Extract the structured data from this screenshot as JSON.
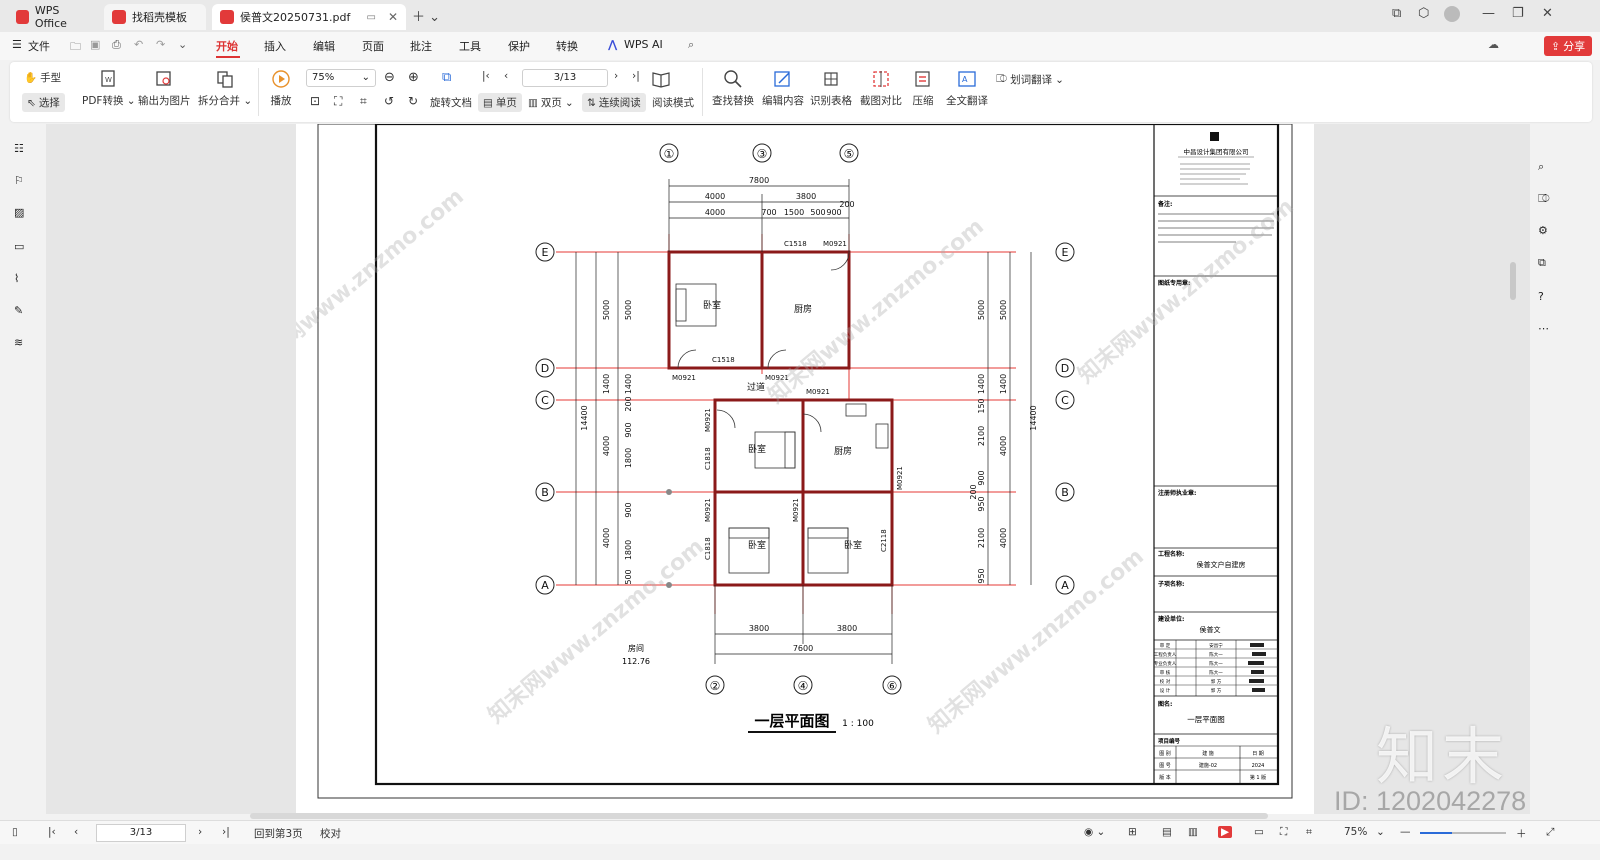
{
  "tabs": [
    {
      "label": "WPS Office"
    },
    {
      "label": "找稻壳模板"
    },
    {
      "label": "侯普文20250731.pdf"
    }
  ],
  "menu": {
    "file": "文件",
    "items": [
      "开始",
      "插入",
      "编辑",
      "页面",
      "批注",
      "工具",
      "保护",
      "转换"
    ],
    "wps_ai": "WPS AI",
    "share": "分享"
  },
  "toolbar": {
    "hand": "手型",
    "select": "选择",
    "pdf_convert": "PDF转换",
    "export_image": "输出为图片",
    "split_merge": "拆分合并",
    "play": "播放",
    "zoom_value": "75%",
    "page_value": "3/13",
    "rotate_doc": "旋转文档",
    "single_page": "单页",
    "double_page": "双页",
    "continuous": "连续阅读",
    "read_mode": "阅读模式",
    "find_replace": "查找替换",
    "edit_content": "编辑内容",
    "recognize_table": "识别表格",
    "screenshot_compare": "截图对比",
    "compress": "压缩",
    "full_translate": "全文翻译",
    "word_translate": "划词翻译"
  },
  "drawing": {
    "title": "一层平面图",
    "scale": "1 : 100",
    "axis_top": [
      "①",
      "③",
      "⑤"
    ],
    "axis_bottom": [
      "②",
      "④",
      "⑥"
    ],
    "axis_rows": [
      "E",
      "D",
      "C",
      "B",
      "A"
    ],
    "dims_top": [
      "7800",
      "4000",
      "3800",
      "4000",
      "700",
      "1500",
      "500",
      "900",
      "200"
    ],
    "dims_bottom": [
      "3800",
      "3800",
      "7600"
    ],
    "dims_left_outer": "14400",
    "dims_left": [
      "5000",
      "5000",
      "1400",
      "1400",
      "4000",
      "4000",
      "200",
      "500",
      "900",
      "1800",
      "200",
      "500",
      "900",
      "1800",
      "500"
    ],
    "dims_right": [
      "5000",
      "5000",
      "1400",
      "1400",
      "4000",
      "4000",
      "150",
      "2100",
      "350",
      "200",
      "900",
      "950",
      "2100",
      "950"
    ],
    "dims_right_outer": "14400",
    "rooms": [
      "卧室",
      "厨房",
      "过道",
      "卧室",
      "厨房",
      "卧室",
      "卧室"
    ],
    "door_window_labels": [
      "C1518",
      "M0921",
      "C1518",
      "M0921",
      "M0921",
      "M0921",
      "M0921",
      "C1818",
      "M0921",
      "M0921",
      "C1818",
      "C2118",
      "M0921"
    ],
    "area_label": "房间",
    "area_value": "112.76",
    "title_block": {
      "company": "中昌设计集团有限公司",
      "notes_label": "备注:",
      "stamp_label": "图纸专用章:",
      "reg_label": "注册师执业章:",
      "project_label": "工程名称:",
      "project_value": "侯普文户自建房",
      "subitem_label": "子项名称:",
      "client_label": "建设单位:",
      "client_value": "侯普文",
      "drawing_name_label": "图名:",
      "drawing_name_value": "一层平面图",
      "proj_no_label": "项目编号",
      "sig_rows": [
        "审 定",
        "工程负责人",
        "专业负责人",
        "审 核",
        "校 对",
        "设 计"
      ],
      "sig_names": [
        "安昌宁",
        "陈大一",
        "陈大一",
        "陈大一",
        "郭 方",
        "郭 方"
      ],
      "row1": [
        "图 别",
        "建 施",
        "日 期"
      ],
      "row2": [
        "图 号",
        "建施-02",
        "2024"
      ],
      "row3": [
        "版 本",
        "",
        "第 1 版"
      ]
    }
  },
  "statusbar": {
    "page_value": "3/13",
    "back_to_page": "回到第3页",
    "proofread": "校对",
    "zoom": "75%"
  },
  "watermark": {
    "text": "知末网www.znzmo.com",
    "brand": "知末",
    "id": "ID: 1202042278"
  },
  "colors": {
    "accent": "#d33333",
    "share_bg": "#e23a3a",
    "axis_red": "#e53935"
  }
}
